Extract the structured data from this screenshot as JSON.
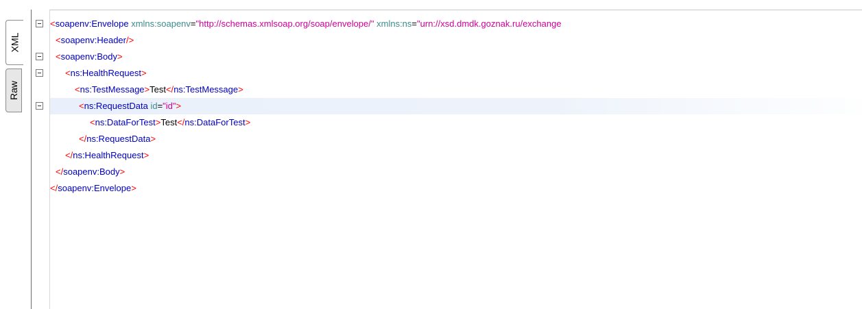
{
  "tabs": [
    {
      "label": "XML",
      "active": true
    },
    {
      "label": "Raw",
      "active": false
    }
  ],
  "lines": [
    {
      "indent": 14,
      "fold": true,
      "highlight": false,
      "tokens": [
        {
          "k": "br",
          "t": "<"
        },
        {
          "k": "tag",
          "t": "soapenv:Envelope"
        },
        {
          "k": "text",
          "t": " "
        },
        {
          "k": "attr",
          "t": "xmlns:soapenv"
        },
        {
          "k": "eq",
          "t": "="
        },
        {
          "k": "val",
          "t": "\"http://schemas.xmlsoap.org/soap/envelope/\""
        },
        {
          "k": "text",
          "t": " "
        },
        {
          "k": "attr",
          "t": "xmlns:ns"
        },
        {
          "k": "eq",
          "t": "="
        },
        {
          "k": "val",
          "t": "\"urn://xsd.dmdk.goznak.ru/exchange"
        }
      ]
    },
    {
      "indent": 22,
      "fold": false,
      "highlight": false,
      "tokens": [
        {
          "k": "br",
          "t": "<"
        },
        {
          "k": "tag",
          "t": "soapenv:Header"
        },
        {
          "k": "br",
          "t": "/>"
        }
      ]
    },
    {
      "indent": 22,
      "fold": true,
      "highlight": false,
      "tokens": [
        {
          "k": "br",
          "t": "<"
        },
        {
          "k": "tag",
          "t": "soapenv:Body"
        },
        {
          "k": "br",
          "t": ">"
        }
      ]
    },
    {
      "indent": 36,
      "fold": true,
      "highlight": false,
      "tokens": [
        {
          "k": "br",
          "t": "<"
        },
        {
          "k": "tag",
          "t": "ns:HealthRequest"
        },
        {
          "k": "br",
          "t": ">"
        }
      ]
    },
    {
      "indent": 50,
      "fold": false,
      "highlight": false,
      "tokens": [
        {
          "k": "br",
          "t": "<"
        },
        {
          "k": "tag",
          "t": "ns:TestMessage"
        },
        {
          "k": "br",
          "t": ">"
        },
        {
          "k": "text",
          "t": "Test"
        },
        {
          "k": "br",
          "t": "</"
        },
        {
          "k": "tag",
          "t": "ns:TestMessage"
        },
        {
          "k": "br",
          "t": ">"
        }
      ]
    },
    {
      "indent": 56,
      "fold": true,
      "highlight": true,
      "tokens": [
        {
          "k": "br",
          "t": "<"
        },
        {
          "k": "tag",
          "t": "ns:RequestData"
        },
        {
          "k": "text",
          "t": " "
        },
        {
          "k": "attr",
          "t": "id"
        },
        {
          "k": "eq",
          "t": "="
        },
        {
          "k": "val",
          "t": "\"id\""
        },
        {
          "k": "br",
          "t": ">"
        }
      ]
    },
    {
      "indent": 72,
      "fold": false,
      "highlight": false,
      "tokens": [
        {
          "k": "br",
          "t": "<"
        },
        {
          "k": "tag",
          "t": "ns:DataForTest"
        },
        {
          "k": "br",
          "t": ">"
        },
        {
          "k": "text",
          "t": "Test"
        },
        {
          "k": "br",
          "t": "</"
        },
        {
          "k": "tag",
          "t": "ns:DataForTest"
        },
        {
          "k": "br",
          "t": ">"
        }
      ]
    },
    {
      "indent": 56,
      "fold": false,
      "highlight": false,
      "tokens": [
        {
          "k": "br",
          "t": "</"
        },
        {
          "k": "tag",
          "t": "ns:RequestData"
        },
        {
          "k": "br",
          "t": ">"
        }
      ]
    },
    {
      "indent": 36,
      "fold": false,
      "highlight": false,
      "tokens": [
        {
          "k": "br",
          "t": "</"
        },
        {
          "k": "tag",
          "t": "ns:HealthRequest"
        },
        {
          "k": "br",
          "t": ">"
        }
      ]
    },
    {
      "indent": 22,
      "fold": false,
      "highlight": false,
      "tokens": [
        {
          "k": "br",
          "t": "</"
        },
        {
          "k": "tag",
          "t": "soapenv:Body"
        },
        {
          "k": "br",
          "t": ">"
        }
      ]
    },
    {
      "indent": 14,
      "fold": false,
      "highlight": false,
      "tokens": [
        {
          "k": "br",
          "t": "</"
        },
        {
          "k": "tag",
          "t": "soapenv:Envelope"
        },
        {
          "k": "br",
          "t": ">"
        }
      ]
    }
  ],
  "colors": {
    "bracket": "#ff0000",
    "tag_name": "#0000c0",
    "attribute": "#3c8c8c",
    "value": "#d10099",
    "text": "#000000",
    "line_highlight": "#e9f0fb"
  }
}
